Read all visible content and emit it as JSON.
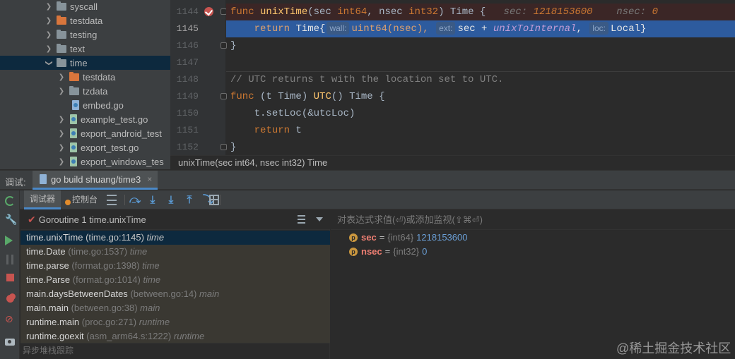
{
  "project_tree": {
    "items": [
      {
        "label": "syscall",
        "kind": "folder",
        "expanded": false
      },
      {
        "label": "testdata",
        "kind": "folder-orange",
        "expanded": false
      },
      {
        "label": "testing",
        "kind": "folder",
        "expanded": false
      },
      {
        "label": "text",
        "kind": "folder",
        "expanded": false
      },
      {
        "label": "time",
        "kind": "folder",
        "expanded": true
      },
      {
        "label": "testdata",
        "kind": "folder-orange",
        "expanded": false
      },
      {
        "label": "tzdata",
        "kind": "folder",
        "expanded": false
      },
      {
        "label": "embed.go",
        "kind": "go-file"
      },
      {
        "label": "example_test.go",
        "kind": "go-test-file"
      },
      {
        "label": "export_android_test",
        "kind": "go-test-file"
      },
      {
        "label": "export_test.go",
        "kind": "go-test-file"
      },
      {
        "label": "export_windows_tes",
        "kind": "go-test-file"
      }
    ]
  },
  "editor": {
    "line_numbers": [
      "1144",
      "1145",
      "1146",
      "1147",
      "1148",
      "1149",
      "1150",
      "1151",
      "1152"
    ],
    "current_line": "1145",
    "breakpoint_line": "1144",
    "line1144": {
      "kw_func": "func",
      "name": "unixTime",
      "open": "(sec ",
      "t1": "int64",
      "mid": ", nsec ",
      "t2": "int32",
      "close": ") ",
      "ret": "Time",
      "brace": " {",
      "inlay_sec_label": "sec: ",
      "inlay_sec_val": "1218153600",
      "inlay_nsec_label": "nsec: ",
      "inlay_nsec_val": "0"
    },
    "line1145": {
      "kw_return": "return",
      "ctor": "Time{",
      "hint_wall": "wall:",
      "p1": "uint64(nsec), ",
      "hint_ext": "ext:",
      "p2": "sec + ",
      "p3": "unixToInternal",
      "p4": ", ",
      "hint_loc": "loc:",
      "p5": "Local}"
    },
    "line1146": "}",
    "line1148": "// UTC returns t with the location set to UTC.",
    "line1149": {
      "kw_func": "func",
      "recv": " (t ",
      "recv_type": "Time",
      "recv_close": ") ",
      "name": "UTC",
      "args": "() ",
      "ret": "Time",
      "brace": " {"
    },
    "line1150": "t.setLoc(&utcLoc)",
    "line1151": {
      "kw_return": "return",
      "value": " t"
    },
    "line1152": "}",
    "breadcrumb": "unixTime(sec int64, nsec int32) Time"
  },
  "debug": {
    "title": "调试:",
    "session_tab": "go build shuang/time3",
    "session_close": "×",
    "tabs": {
      "debugger": "调试器",
      "console": "控制台"
    },
    "toolbar_icons": [
      "menu-icon",
      "show-execution-point-icon",
      "step-over-icon",
      "step-into-icon",
      "step-out-icon",
      "run-to-cursor-icon",
      "table-icon"
    ],
    "goroutine": "Goroutine 1 time.unixTime",
    "frames": [
      {
        "name": "time.unixTime",
        "loc": "(time.go:1145)",
        "pkg": "time",
        "selected": true
      },
      {
        "name": "time.Date",
        "loc": "(time.go:1537)",
        "pkg": "time",
        "selected": false
      },
      {
        "name": "time.parse",
        "loc": "(format.go:1398)",
        "pkg": "time",
        "selected": false
      },
      {
        "name": "time.Parse",
        "loc": "(format.go:1014)",
        "pkg": "time",
        "selected": false
      },
      {
        "name": "main.daysBetweenDates",
        "loc": "(between.go:14)",
        "pkg": "main",
        "selected": false
      },
      {
        "name": "main.main",
        "loc": "(between.go:38)",
        "pkg": "main",
        "selected": false
      },
      {
        "name": "runtime.main",
        "loc": "(proc.go:271)",
        "pkg": "runtime",
        "selected": false
      },
      {
        "name": "runtime.goexit",
        "loc": "(asm_arm64.s:1222)",
        "pkg": "runtime",
        "selected": false
      }
    ],
    "async_trace": "异步堆栈跟踪",
    "eval_placeholder": "对表达式求值(⏎)或添加监视(⇧⌘⏎)",
    "variables": [
      {
        "name": "sec",
        "type": "{int64}",
        "value": "1218153600"
      },
      {
        "name": "nsec",
        "type": "{int32}",
        "value": "0"
      }
    ]
  },
  "watermark": "@稀土掘金技术社区",
  "colors": {
    "exec_line": "#2d5b9e",
    "breakpoint": "#c75450",
    "selection": "#0d293e",
    "accent_tab": "#4a88c7"
  }
}
